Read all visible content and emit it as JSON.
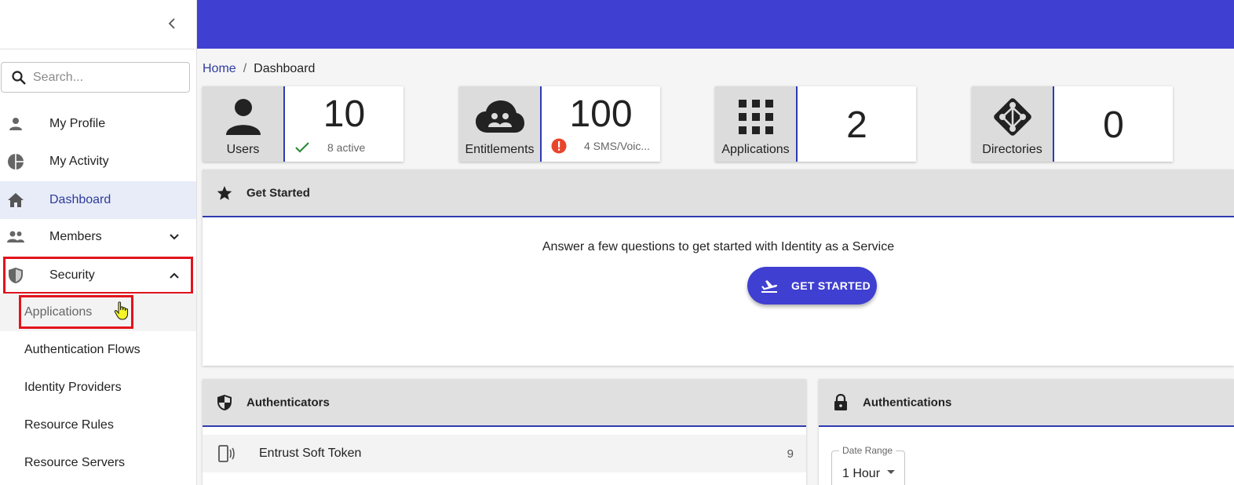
{
  "sidebar": {
    "search_placeholder": "Search...",
    "items": [
      {
        "label": "My Profile",
        "icon": "person-icon"
      },
      {
        "label": "My Activity",
        "icon": "pie-chart-icon"
      },
      {
        "label": "Dashboard",
        "icon": "home-icon",
        "active": true
      },
      {
        "label": "Members",
        "icon": "people-icon",
        "expandable": true
      },
      {
        "label": "Security",
        "icon": "shield-icon",
        "expanded": true
      }
    ],
    "security_subitems": [
      {
        "label": "Applications"
      },
      {
        "label": "Authentication Flows"
      },
      {
        "label": "Identity Providers"
      },
      {
        "label": "Resource Rules"
      },
      {
        "label": "Resource Servers"
      }
    ]
  },
  "header": {
    "accent_color": "#3f3fd1"
  },
  "breadcrumb": {
    "home": "Home",
    "separator": "/",
    "current": "Dashboard"
  },
  "stats": [
    {
      "label": "Users",
      "value": "10",
      "status_icon": "check-icon",
      "status_text": "8 active"
    },
    {
      "label": "Entitlements",
      "value": "100",
      "status_icon": "error-icon",
      "status_text": "4 SMS/Voic..."
    },
    {
      "label": "Applications",
      "value": "2"
    },
    {
      "label": "Directories",
      "value": "0"
    }
  ],
  "get_started": {
    "title": "Get Started",
    "message": "Answer a few questions to get started with Identity as a Service",
    "button_label": "GET STARTED"
  },
  "authenticators": {
    "title": "Authenticators",
    "rows": [
      {
        "name": "Entrust Soft Token",
        "count": "9"
      }
    ]
  },
  "authentications": {
    "title": "Authentications",
    "date_range_label": "Date Range",
    "date_range_value": "1 Hour"
  }
}
